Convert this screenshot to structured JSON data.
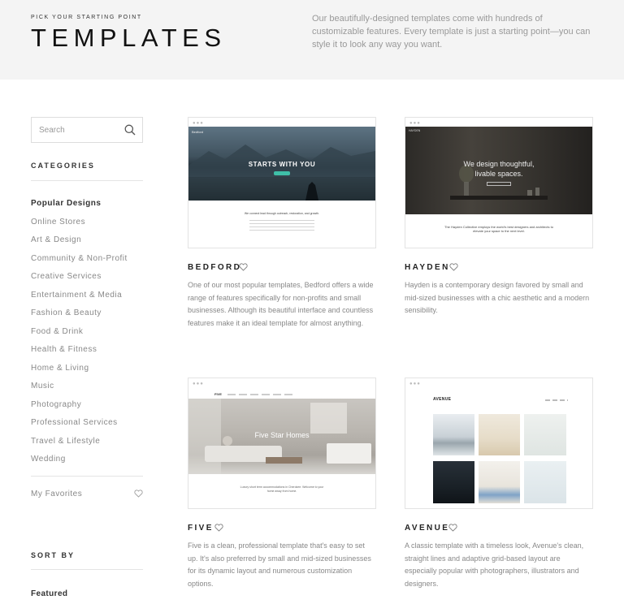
{
  "hero": {
    "kicker": "PICK YOUR STARTING POINT",
    "title": "TEMPLATES",
    "description": "Our beautifully-designed templates come with hundreds of customizable features. Every template is just a starting point—you can style it to look any way you want."
  },
  "sidebar": {
    "search_placeholder": "Search",
    "categories_heading": "CATEGORIES",
    "categories": [
      "Popular Designs",
      "Online Stores",
      "Art & Design",
      "Community & Non-Profit",
      "Creative Services",
      "Entertainment & Media",
      "Fashion & Beauty",
      "Food & Drink",
      "Health & Fitness",
      "Home & Living",
      "Music",
      "Photography",
      "Professional Services",
      "Travel & Lifestyle",
      "Wedding"
    ],
    "active_category": "Popular Designs",
    "favorites_label": "My Favorites",
    "sort_heading": "SORT BY",
    "sort_value": "Featured"
  },
  "templates": [
    {
      "name": "BEDFORD",
      "description": "One of our most popular templates, Bedford offers a wide range of features specifically for non-profits and small businesses. Although its beautiful interface and countless features make it an ideal template for almost anything.",
      "preview": {
        "logo": "Bedford",
        "headline": "STARTS WITH YOU",
        "tagline": "We connect lead through outreach, restoration, and growth."
      }
    },
    {
      "name": "HAYDEN",
      "description": "Hayden is a contemporary design favored by small and mid-sized businesses with a chic aesthetic and a modern sensibility.",
      "preview": {
        "logo": "HAYDEN",
        "headline": "We design thoughtful, livable spaces.",
        "tagline": "The Hayden Collective employs the world's best designers and architects to elevate your space to the next level."
      }
    },
    {
      "name": "FIVE",
      "description": "Five is a clean, professional template that's easy to set up. It's also preferred by small and mid-sized businesses for its dynamic layout and numerous customization options.",
      "preview": {
        "logo": "FIVE",
        "headline": "Five Star Homes",
        "tagline": "Luxury short term accommodations in Cherokee. Welcome to your home away from home."
      }
    },
    {
      "name": "AVENUE",
      "description": "A classic template with a timeless look, Avenue's clean, straight lines and adaptive grid-based layout are especially popular with photographers, illustrators and designers.",
      "preview": {
        "logo": "AVENUE"
      }
    }
  ],
  "colors": {
    "hero_bg": "#f4f4f4",
    "text_dark": "#222222",
    "text_muted": "#888888",
    "accent_teal": "#3fbfa8"
  },
  "icons": {
    "search": "search-icon",
    "heart": "heart-outline-icon"
  }
}
